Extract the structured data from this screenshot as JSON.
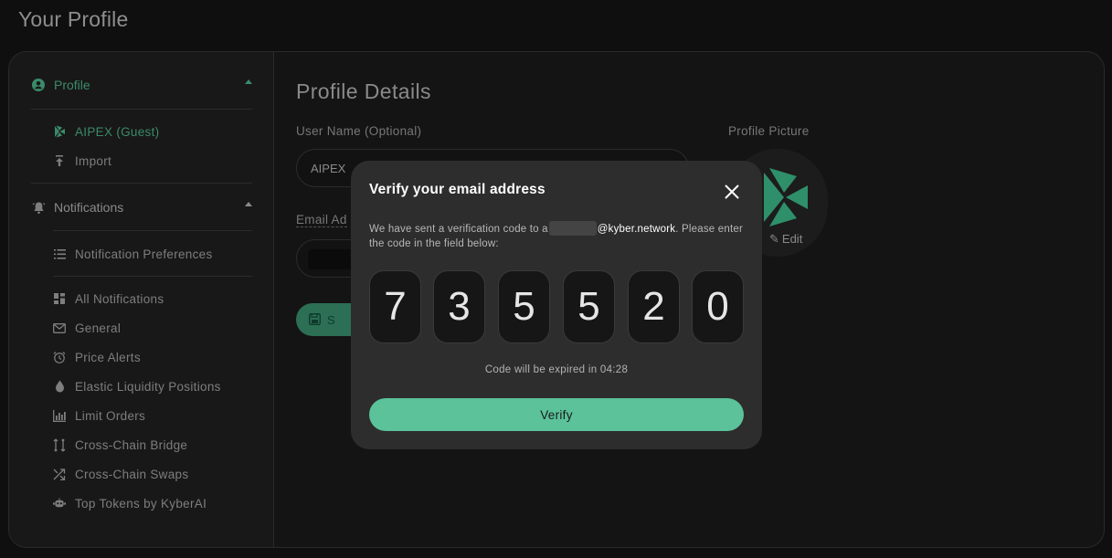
{
  "page": {
    "title": "Your Profile"
  },
  "sidebar": {
    "profile_header": "Profile",
    "profile_items": [
      {
        "label": "AIPEX (Guest)",
        "icon": "kyber-logo-icon"
      },
      {
        "label": "Import",
        "icon": "import-icon"
      }
    ],
    "notifications_header": "Notifications",
    "preferences_label": "Notification Preferences",
    "notification_items": [
      {
        "label": "All Notifications",
        "icon": "grid-icon"
      },
      {
        "label": "General",
        "icon": "mail-icon"
      },
      {
        "label": "Price Alerts",
        "icon": "alarm-clock-icon"
      },
      {
        "label": "Elastic Liquidity Positions",
        "icon": "droplet-icon"
      },
      {
        "label": "Limit Orders",
        "icon": "bar-chart-icon"
      },
      {
        "label": "Cross-Chain Bridge",
        "icon": "bridge-icon"
      },
      {
        "label": "Cross-Chain Swaps",
        "icon": "shuffle-icon"
      },
      {
        "label": "Top Tokens by KyberAI",
        "icon": "robot-icon"
      }
    ]
  },
  "main": {
    "title": "Profile Details",
    "username_label": "User Name (Optional)",
    "username_value": "AIPEX",
    "email_label": "Email Ad",
    "save_label": "S",
    "picture_label": "Profile Picture",
    "edit_label": "Edit"
  },
  "modal": {
    "title": "Verify your email address",
    "text_before": "We have sent a verification code to a",
    "email_visible": "@kyber.network",
    "text_after": ". Please enter the code in the field below:",
    "code": [
      "7",
      "3",
      "5",
      "5",
      "2",
      "0"
    ],
    "expire_text": "Code will be expired in 04:28",
    "verify_label": "Verify"
  },
  "colors": {
    "accent": "#5bc29a",
    "accent_dim": "#3b8a6a",
    "modal_bg": "#2d2d2d"
  }
}
